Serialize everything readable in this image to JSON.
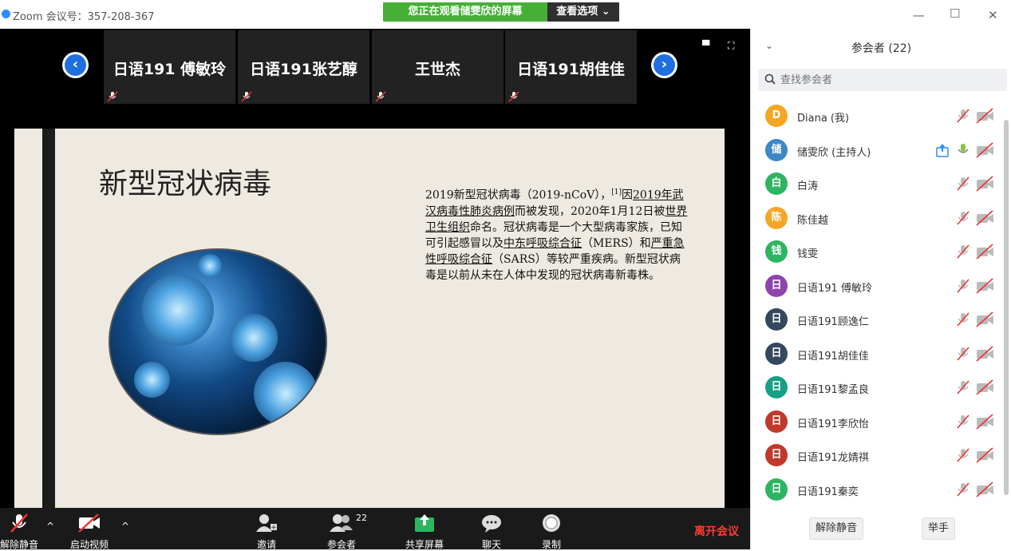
{
  "window": {
    "title": "Zoom 会议号：357-208-367"
  },
  "banner": {
    "text": "您正在观看储雯欣的屏幕",
    "view_options": "查看选项 ⌄"
  },
  "strip": {
    "participants": [
      "日语191 傅敏玲",
      "日语191张艺醇",
      "王世杰",
      "日语191胡佳佳"
    ]
  },
  "slide": {
    "title": "新型冠状病毒",
    "body_parts": {
      "p1": "2019新型冠状病毒（2019-nCoV），",
      "ref": "[1]",
      "p2": "因",
      "link1": "2019年武汉病毒性肺炎病例",
      "p3": "而被发现，2020年1月12日被",
      "link2": "世界卫生组织",
      "p4": "命名。冠状病毒是一个大型病毒家族，已知可引起感冒以及",
      "link3": "中东呼吸综合征",
      "p5": "（MERS）和",
      "link4": "严重急性呼吸综合征",
      "p6": "（SARS）等较严重疾病。新型冠状病毒是以前从未在人体中发现的冠状病毒新毒株。"
    }
  },
  "toolbar": {
    "unmute": "解除静音",
    "start_video": "启动视频",
    "invite": "邀请",
    "participants": "参会者",
    "participants_count": "22",
    "share": "共享屏幕",
    "chat": "聊天",
    "record": "录制",
    "leave": "离开会议"
  },
  "panel": {
    "title": "参会者 (22)",
    "search_placeholder": "查找参会者",
    "participants": [
      {
        "initial": "D",
        "name": "Diana (我)",
        "color": "#f5a623"
      },
      {
        "initial": "储",
        "name": "储雯欣 (主持人)",
        "color": "#3b87c8"
      },
      {
        "initial": "白",
        "name": "白涛",
        "color": "#2db562"
      },
      {
        "initial": "陈",
        "name": "陈佳越",
        "color": "#f5a623"
      },
      {
        "initial": "钱",
        "name": "钱雯",
        "color": "#2db562"
      },
      {
        "initial": "日",
        "name": "日语191 傅敏玲",
        "color": "#8e44ad"
      },
      {
        "initial": "日",
        "name": "日语191顾逸仁",
        "color": "#34495e"
      },
      {
        "initial": "日",
        "name": "日语191胡佳佳",
        "color": "#34495e"
      },
      {
        "initial": "日",
        "name": "日语191黎孟良",
        "color": "#16a085"
      },
      {
        "initial": "日",
        "name": "日语191李欣怡",
        "color": "#c0392b"
      },
      {
        "initial": "日",
        "name": "日语191龙婧祺",
        "color": "#c0392b"
      },
      {
        "initial": "日",
        "name": "日语191秦奕",
        "color": "#2db562"
      }
    ],
    "unmute_all": "解除静音",
    "raise_hand": "举手"
  }
}
